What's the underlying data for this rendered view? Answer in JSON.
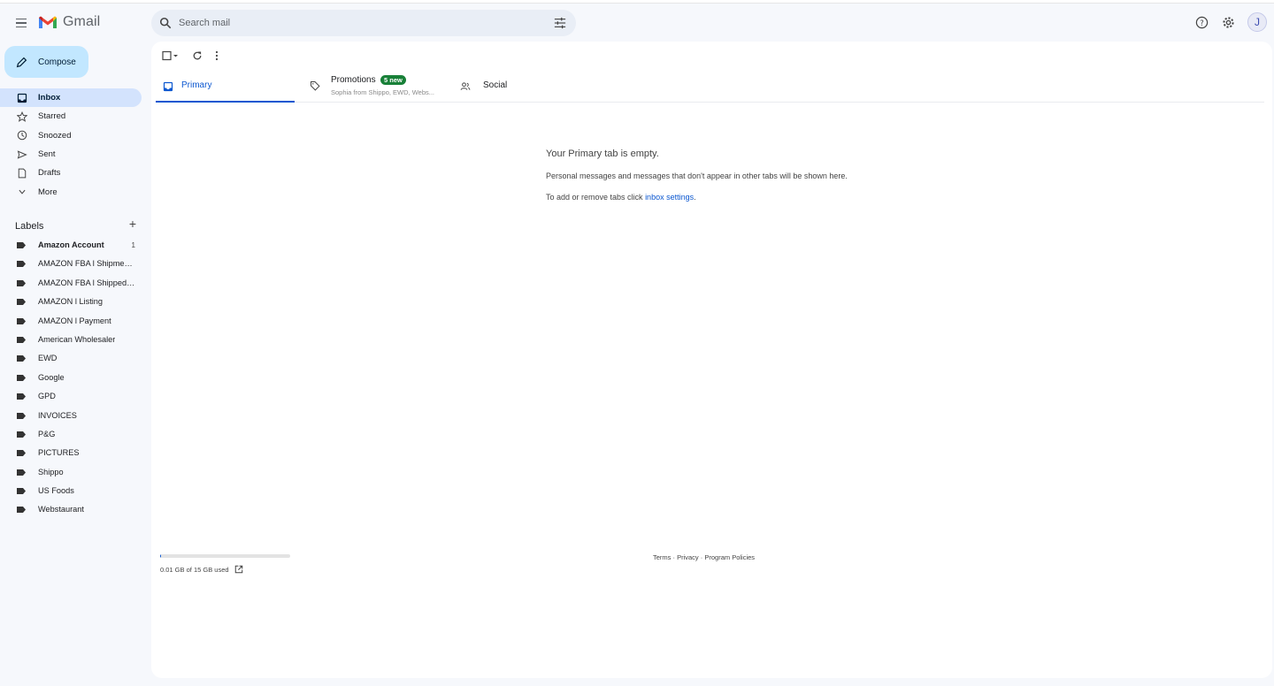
{
  "header": {
    "app_name": "Gmail",
    "search_placeholder": "Search mail",
    "avatar_letter": "J"
  },
  "sidebar": {
    "compose_label": "Compose",
    "nav": [
      {
        "label": "Inbox",
        "icon": "inbox-icon",
        "active": true
      },
      {
        "label": "Starred",
        "icon": "star-icon"
      },
      {
        "label": "Snoozed",
        "icon": "clock-icon"
      },
      {
        "label": "Sent",
        "icon": "send-icon"
      },
      {
        "label": "Drafts",
        "icon": "draft-icon"
      },
      {
        "label": "More",
        "icon": "chevron-down-icon"
      }
    ],
    "labels_title": "Labels",
    "labels": [
      {
        "name": "Amazon Account",
        "count": "1",
        "bold": true
      },
      {
        "name": "AMAZON FBA l Shipmen..."
      },
      {
        "name": "AMAZON FBA l Shipped ..."
      },
      {
        "name": "AMAZON l Listing"
      },
      {
        "name": "AMAZON l Payment"
      },
      {
        "name": "American Wholesaler"
      },
      {
        "name": "EWD"
      },
      {
        "name": "Google"
      },
      {
        "name": "GPD"
      },
      {
        "name": "INVOICES"
      },
      {
        "name": "P&G"
      },
      {
        "name": "PICTURES"
      },
      {
        "name": "Shippo"
      },
      {
        "name": "US Foods"
      },
      {
        "name": "Webstaurant"
      }
    ]
  },
  "tabs": {
    "primary": "Primary",
    "promotions": "Promotions",
    "promotions_badge": "5 new",
    "promotions_sub": "Sophia from Shippo, EWD, Webs...",
    "social": "Social"
  },
  "empty_state": {
    "title": "Your Primary tab is empty.",
    "line1": "Personal messages and messages that don't appear in other tabs will be shown here.",
    "line2_prefix": "To add or remove tabs click ",
    "line2_link": "inbox settings",
    "line2_suffix": "."
  },
  "footer": {
    "storage_text": "0.01 GB of 15 GB used",
    "storage_fraction": 0.001,
    "terms": "Terms",
    "privacy": "Privacy",
    "policies": "Program Policies",
    "sep": " · "
  },
  "colors": {
    "accent": "#0b57d0",
    "compose_bg": "#c2e7ff",
    "active_nav_bg": "#d3e3fd",
    "badge_green": "#188038"
  }
}
